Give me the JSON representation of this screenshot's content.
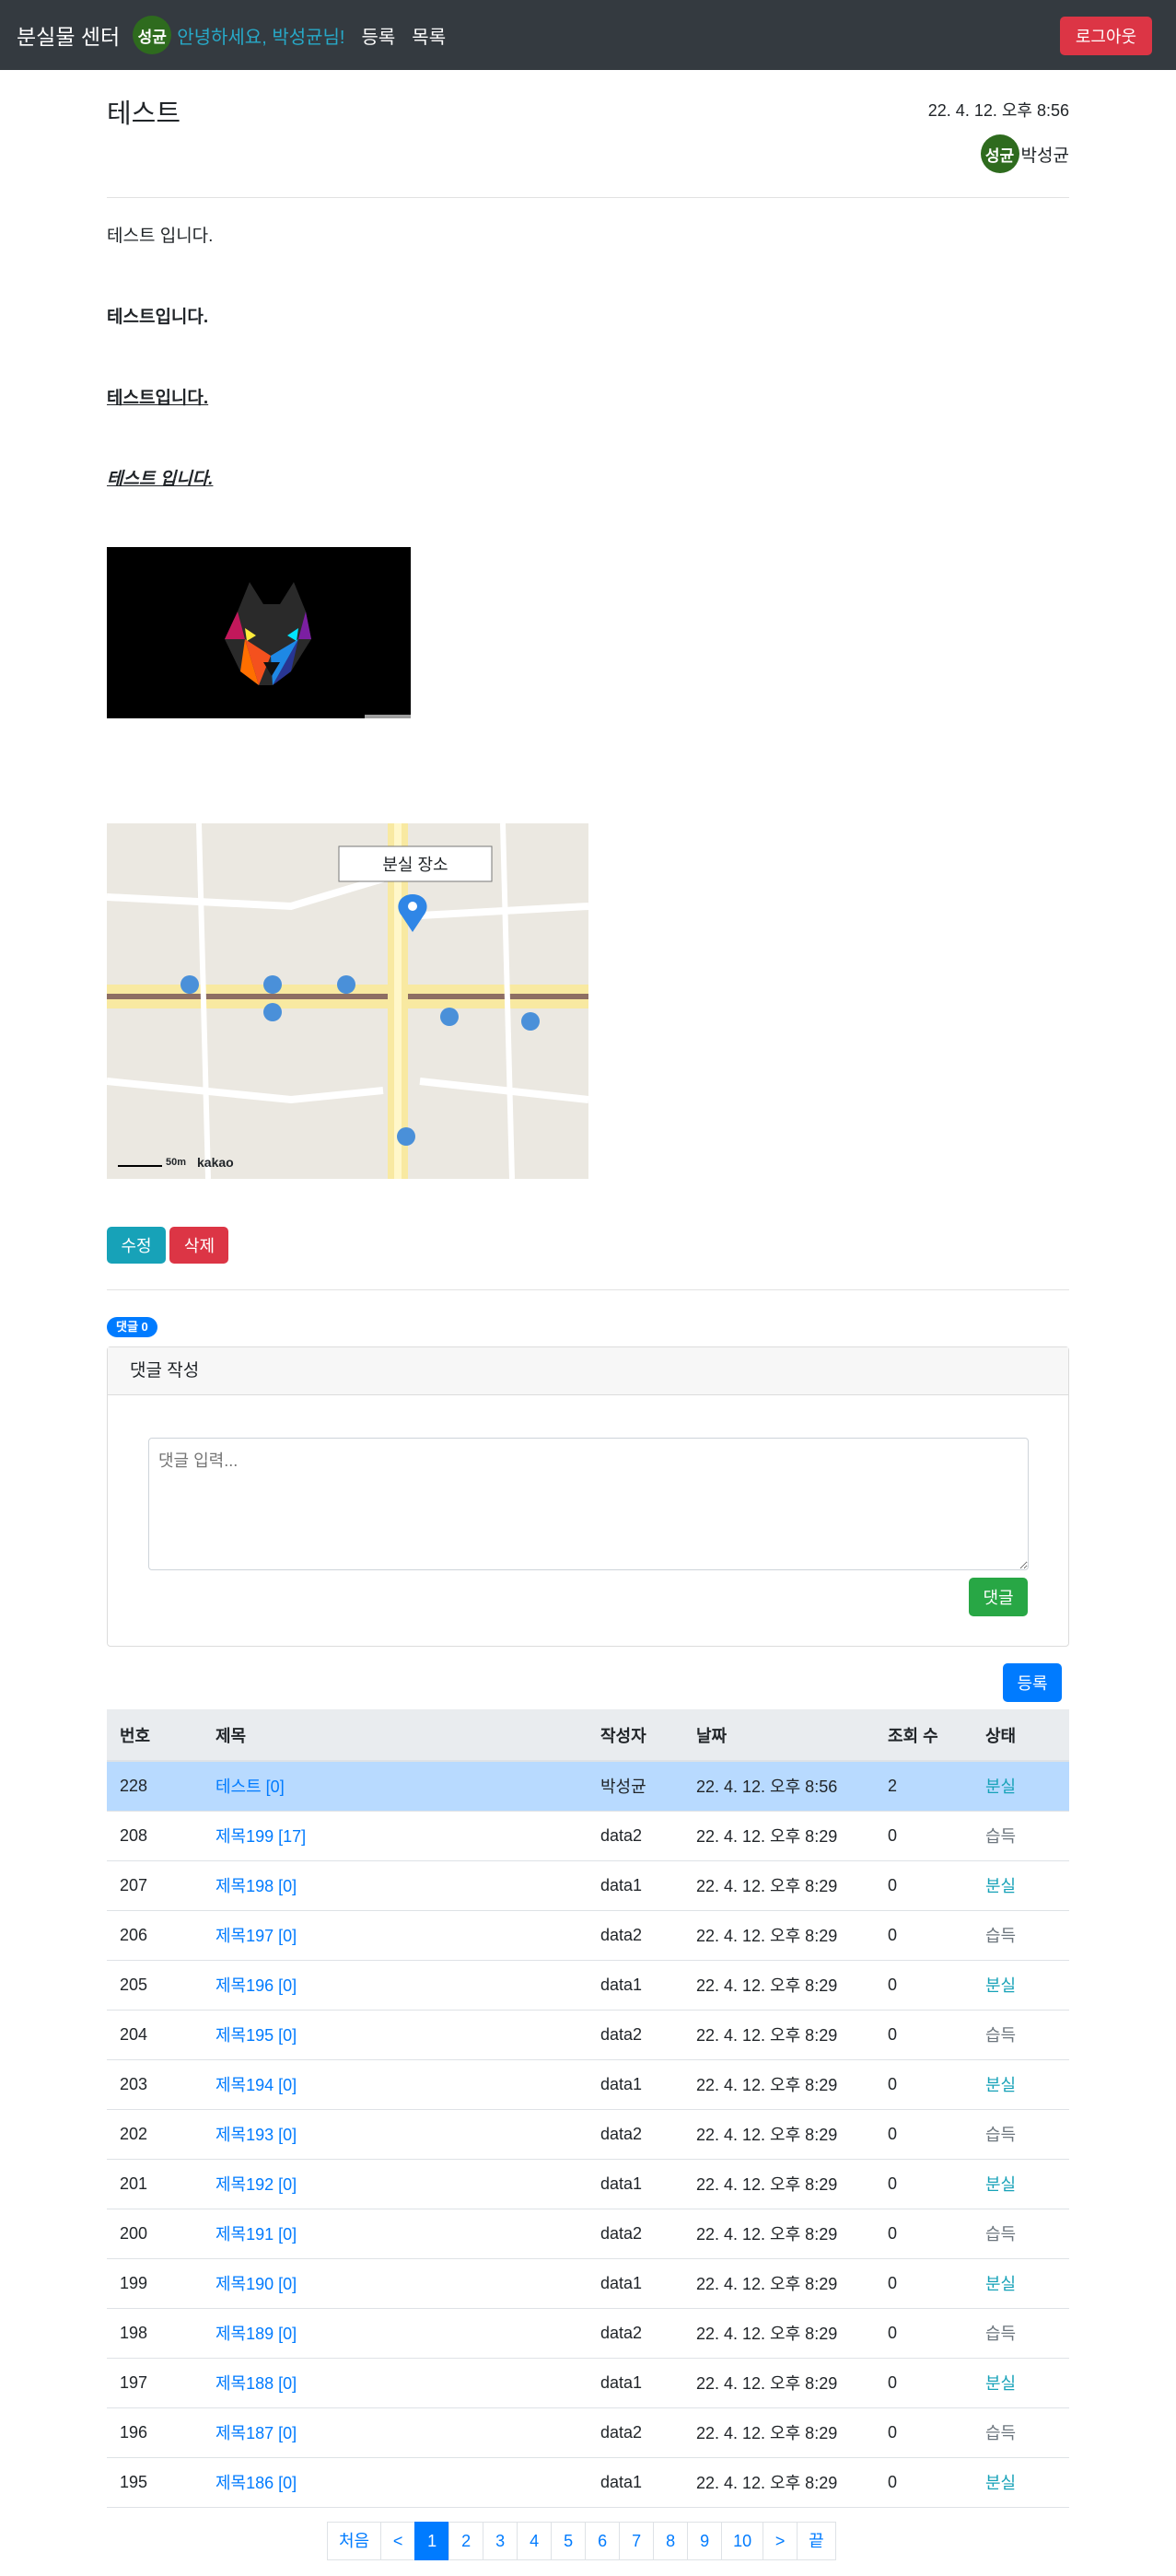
{
  "navbar": {
    "brand": "분실물 센터",
    "avatar": "성균",
    "greeting": "안녕하세요, 박성균님!",
    "links": [
      "등록",
      "목록"
    ],
    "logout": "로그아웃"
  },
  "post": {
    "title": "테스트",
    "date": "22. 4. 12. 오후 8:56",
    "author_avatar": "성균",
    "author": "박성균",
    "lines": [
      "테스트 입니다.",
      "테스트입니다.",
      "테스트입니다. ",
      "테스트 입니다."
    ],
    "map_label": "분실 장소",
    "map_scale": "50m",
    "map_brand": "kakao"
  },
  "actions": {
    "edit": "수정",
    "delete": "삭제"
  },
  "comments": {
    "badge": "댓글 0",
    "card_title": "댓글 작성",
    "placeholder": "댓글 입력...",
    "submit": "댓글"
  },
  "list": {
    "register": "등록",
    "headers": [
      "번호",
      "제목",
      "작성자",
      "날짜",
      "조회 수",
      "상태"
    ],
    "rows": [
      {
        "no": "228",
        "title": "테스트 [0]",
        "writer": "박성균",
        "date": "22. 4. 12. 오후 8:56",
        "views": "2",
        "status": "분실"
      },
      {
        "no": "208",
        "title": "제목199 [17]",
        "writer": "data2",
        "date": "22. 4. 12. 오후 8:29",
        "views": "0",
        "status": "습득"
      },
      {
        "no": "207",
        "title": "제목198 [0]",
        "writer": "data1",
        "date": "22. 4. 12. 오후 8:29",
        "views": "0",
        "status": "분실"
      },
      {
        "no": "206",
        "title": "제목197 [0]",
        "writer": "data2",
        "date": "22. 4. 12. 오후 8:29",
        "views": "0",
        "status": "습득"
      },
      {
        "no": "205",
        "title": "제목196 [0]",
        "writer": "data1",
        "date": "22. 4. 12. 오후 8:29",
        "views": "0",
        "status": "분실"
      },
      {
        "no": "204",
        "title": "제목195 [0]",
        "writer": "data2",
        "date": "22. 4. 12. 오후 8:29",
        "views": "0",
        "status": "습득"
      },
      {
        "no": "203",
        "title": "제목194 [0]",
        "writer": "data1",
        "date": "22. 4. 12. 오후 8:29",
        "views": "0",
        "status": "분실"
      },
      {
        "no": "202",
        "title": "제목193 [0]",
        "writer": "data2",
        "date": "22. 4. 12. 오후 8:29",
        "views": "0",
        "status": "습득"
      },
      {
        "no": "201",
        "title": "제목192 [0]",
        "writer": "data1",
        "date": "22. 4. 12. 오후 8:29",
        "views": "0",
        "status": "분실"
      },
      {
        "no": "200",
        "title": "제목191 [0]",
        "writer": "data2",
        "date": "22. 4. 12. 오후 8:29",
        "views": "0",
        "status": "습득"
      },
      {
        "no": "199",
        "title": "제목190 [0]",
        "writer": "data1",
        "date": "22. 4. 12. 오후 8:29",
        "views": "0",
        "status": "분실"
      },
      {
        "no": "198",
        "title": "제목189 [0]",
        "writer": "data2",
        "date": "22. 4. 12. 오후 8:29",
        "views": "0",
        "status": "습득"
      },
      {
        "no": "197",
        "title": "제목188 [0]",
        "writer": "data1",
        "date": "22. 4. 12. 오후 8:29",
        "views": "0",
        "status": "분실"
      },
      {
        "no": "196",
        "title": "제목187 [0]",
        "writer": "data2",
        "date": "22. 4. 12. 오후 8:29",
        "views": "0",
        "status": "습득"
      },
      {
        "no": "195",
        "title": "제목186 [0]",
        "writer": "data1",
        "date": "22. 4. 12. 오후 8:29",
        "views": "0",
        "status": "분실"
      }
    ]
  },
  "pagination": [
    "처음",
    "<",
    "1",
    "2",
    "3",
    "4",
    "5",
    "6",
    "7",
    "8",
    "9",
    "10",
    ">",
    "끝"
  ],
  "colors": {
    "navbar": "#343a40",
    "primary": "#007bff",
    "danger": "#dc3545",
    "info": "#17a2b8",
    "success": "#28a745",
    "avatar": "#2e6b1e"
  }
}
